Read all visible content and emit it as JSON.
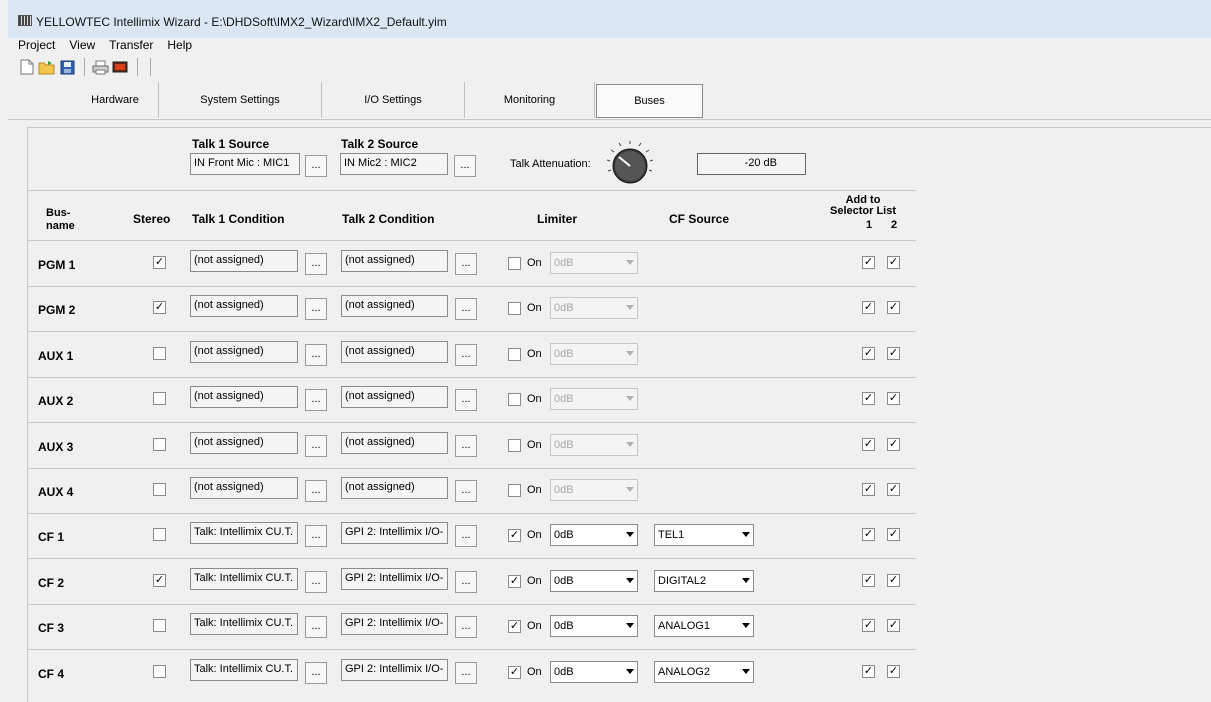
{
  "window": {
    "title": "YELLOWTEC Intellimix Wizard - E:\\DHDSoft\\IMX2_Wizard\\IMX2_Default.yim"
  },
  "menu": [
    "Project",
    "View",
    "Transfer",
    "Help"
  ],
  "toolbar_icons": [
    "new-file-icon",
    "open-folder-icon",
    "save-icon",
    "print-icon",
    "transfer-icon"
  ],
  "tabs": [
    {
      "label": "Hardware"
    },
    {
      "label": "System Settings"
    },
    {
      "label": "I/O Settings"
    },
    {
      "label": "Monitoring"
    },
    {
      "label": "Buses",
      "active": true
    }
  ],
  "talk": {
    "source1_label": "Talk 1 Source",
    "source1_value": "IN Front Mic : MIC1",
    "source2_label": "Talk 2 Source",
    "source2_value": "IN Mic2 : MIC2",
    "attenuation_label": "Talk Attenuation:",
    "attenuation_value": "-20 dB"
  },
  "headers": {
    "busname": "Bus-\nname",
    "stereo": "Stereo",
    "talk1": "Talk 1 Condition",
    "talk2": "Talk 2 Condition",
    "limiter": "Limiter",
    "cfsource": "CF Source",
    "addto": "Add to\nSelector List",
    "col1": "1",
    "col2": "2"
  },
  "dots_label": "...",
  "on_label": "On",
  "rows": [
    {
      "name": "PGM 1",
      "stereo": true,
      "t1": "(not assigned)",
      "t2": "(not assigned)",
      "lim_on": false,
      "lim_val": "0dB",
      "lim_enabled": false,
      "cf": "",
      "sel1": true,
      "sel2": true
    },
    {
      "name": "PGM 2",
      "stereo": true,
      "t1": "(not assigned)",
      "t2": "(not assigned)",
      "lim_on": false,
      "lim_val": "0dB",
      "lim_enabled": false,
      "cf": "",
      "sel1": true,
      "sel2": true
    },
    {
      "name": "AUX 1",
      "stereo": false,
      "t1": "(not assigned)",
      "t2": "(not assigned)",
      "lim_on": false,
      "lim_val": "0dB",
      "lim_enabled": false,
      "cf": "",
      "sel1": true,
      "sel2": true
    },
    {
      "name": "AUX 2",
      "stereo": false,
      "t1": "(not assigned)",
      "t2": "(not assigned)",
      "lim_on": false,
      "lim_val": "0dB",
      "lim_enabled": false,
      "cf": "",
      "sel1": true,
      "sel2": true
    },
    {
      "name": "AUX 3",
      "stereo": false,
      "t1": "(not assigned)",
      "t2": "(not assigned)",
      "lim_on": false,
      "lim_val": "0dB",
      "lim_enabled": false,
      "cf": "",
      "sel1": true,
      "sel2": true
    },
    {
      "name": "AUX 4",
      "stereo": false,
      "t1": "(not assigned)",
      "t2": "(not assigned)",
      "lim_on": false,
      "lim_val": "0dB",
      "lim_enabled": false,
      "cf": "",
      "sel1": true,
      "sel2": true
    },
    {
      "name": "CF 1",
      "stereo": false,
      "t1": "Talk: Intellimix CU.T.",
      "t2": "GPI 2: Intellimix I/O-",
      "lim_on": true,
      "lim_val": "0dB",
      "lim_enabled": true,
      "cf": "TEL1",
      "sel1": true,
      "sel2": true
    },
    {
      "name": "CF 2",
      "stereo": true,
      "t1": "Talk: Intellimix CU.T.",
      "t2": "GPI 2: Intellimix I/O-",
      "lim_on": true,
      "lim_val": "0dB",
      "lim_enabled": true,
      "cf": "DIGITAL2",
      "sel1": true,
      "sel2": true
    },
    {
      "name": "CF 3",
      "stereo": false,
      "t1": "Talk: Intellimix CU.T.",
      "t2": "GPI 2: Intellimix I/O-",
      "lim_on": true,
      "lim_val": "0dB",
      "lim_enabled": true,
      "cf": "ANALOG1",
      "sel1": true,
      "sel2": true
    },
    {
      "name": "CF 4",
      "stereo": false,
      "t1": "Talk: Intellimix CU.T.",
      "t2": "GPI 2: Intellimix I/O-",
      "lim_on": true,
      "lim_val": "0dB",
      "lim_enabled": true,
      "cf": "ANALOG2",
      "sel1": true,
      "sel2": true
    }
  ]
}
